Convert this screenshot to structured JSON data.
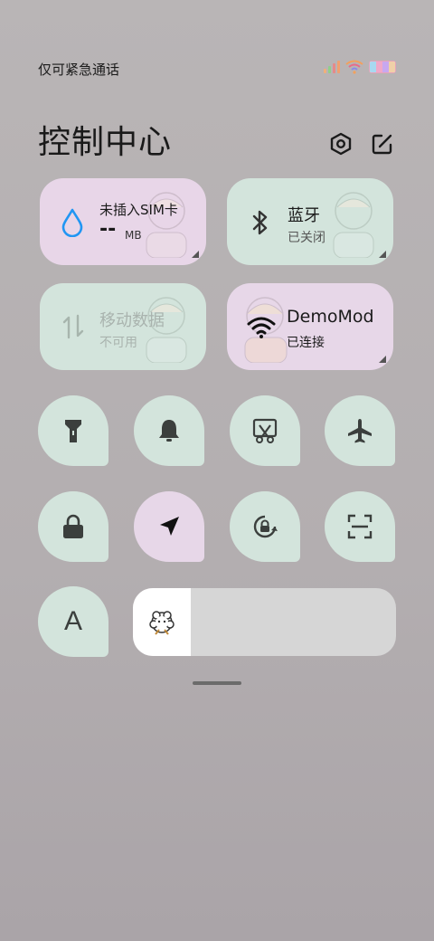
{
  "status": {
    "carrier_text": "仅可紧急通话"
  },
  "header": {
    "title": "控制中心",
    "settings_icon": "settings-hex-icon",
    "edit_icon": "edit-icon"
  },
  "cards": {
    "data_usage": {
      "title": "未插入SIM卡",
      "value": "--",
      "unit": "MB",
      "icon": "water-drop-icon"
    },
    "bluetooth": {
      "title": "蓝牙",
      "status": "已关闭",
      "icon": "bluetooth-icon"
    },
    "mobile_data": {
      "title": "移动数据",
      "status": "不可用",
      "icon": "updown-arrows-icon"
    },
    "wifi": {
      "title": "DemoMod",
      "status": "已连接",
      "icon": "wifi-icon"
    }
  },
  "toggles": [
    {
      "name": "flashlight",
      "icon": "flashlight-icon",
      "active": false
    },
    {
      "name": "ringer",
      "icon": "bell-icon",
      "active": false
    },
    {
      "name": "screenshot",
      "icon": "scissors-icon",
      "active": false
    },
    {
      "name": "airplane-mode",
      "icon": "airplane-icon",
      "active": false
    },
    {
      "name": "lock-screen",
      "icon": "lock-icon",
      "active": false
    },
    {
      "name": "location",
      "icon": "navigation-arrow-icon",
      "active": true
    },
    {
      "name": "auto-rotate",
      "icon": "rotate-lock-icon",
      "active": false
    },
    {
      "name": "scanner",
      "icon": "scan-icon",
      "active": false
    },
    {
      "name": "font-size",
      "label": "A",
      "icon": "font-icon",
      "active": false
    }
  ],
  "brightness": {
    "level_fraction": 0.22,
    "icon": "sun-flower-icon"
  },
  "colors": {
    "mint": "#d3e4dc",
    "lavender": "#e7d7e8",
    "accent_blue": "#2196f3"
  }
}
